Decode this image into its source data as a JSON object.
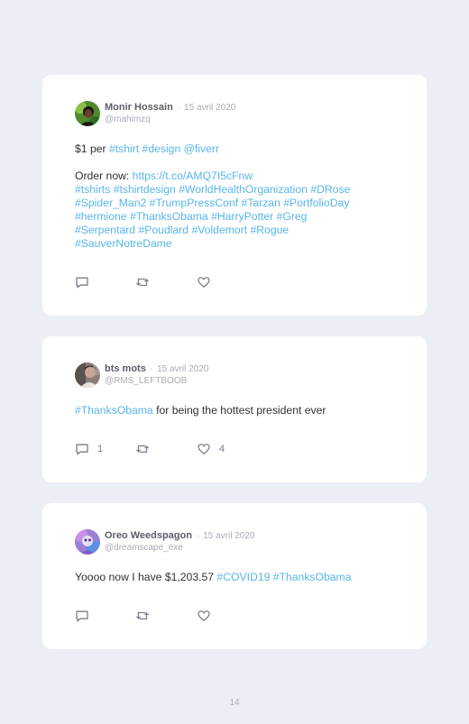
{
  "page_number": "14",
  "colors": {
    "background": "#eceef6",
    "card": "#ffffff",
    "link": "#58b5e8",
    "muted": "#a9abb8"
  },
  "tweets": [
    {
      "name": "Monir Hossain",
      "sep": "·",
      "date": "15 avril 2020",
      "handle": "@mahimzq",
      "avatar": "avatar-photo-green",
      "line1": {
        "t0": "$1 per ",
        "h1": "#tshirt",
        "s1": " ",
        "h2": "#design",
        "s2": " ",
        "h3": "@fiverr"
      },
      "line2": {
        "t0": "Order now: ",
        "link": "https://t.co/AMQ7I5cFnw"
      },
      "line3": {
        "h1": "#tshirts",
        "h2": "#tshirtdesign",
        "h3": "#WorldHealthOrganization",
        "h4": "#DRose"
      },
      "line4": {
        "h1": "#Spider_Man2",
        "h2": "#TrumpPressConf",
        "h3": "#Tarzan",
        "h4": "#PortfolioDay"
      },
      "line5": {
        "h1": "#hermione",
        "h2": "#ThanksObama",
        "h3": "#HarryPotter",
        "h4": "#Greg"
      },
      "line6": {
        "h1": "#Serpentard",
        "h2": "#Poudlard",
        "h3": "#Voldemort",
        "h4": "#Rogue"
      },
      "line7": {
        "h1": "#SauverNotreDame"
      },
      "replies": "",
      "retweets": "",
      "likes": ""
    },
    {
      "name": "bts mots",
      "sep": "·",
      "date": "15 avril 2020",
      "handle": "@RMS_LEFTBOOB",
      "avatar": "avatar-photo-portrait",
      "line1": {
        "h1": "#ThanksObama",
        "t1": " for being the hottest president ever"
      },
      "replies": "1",
      "retweets": "",
      "likes": "4"
    },
    {
      "name": "Oreo Weedspagon",
      "sep": "·",
      "date": "15 avril 2020",
      "handle": "@dreamscape_exe",
      "avatar": "avatar-photo-purple",
      "line1": {
        "t0": "Yoooo now I have $1,203.57 ",
        "h1": "#COVID19",
        "s1": " ",
        "h2": "#ThanksObama"
      },
      "replies": "",
      "retweets": "",
      "likes": ""
    }
  ],
  "icons": {
    "reply": "reply-icon",
    "retweet": "retweet-icon",
    "like": "heart-icon"
  }
}
